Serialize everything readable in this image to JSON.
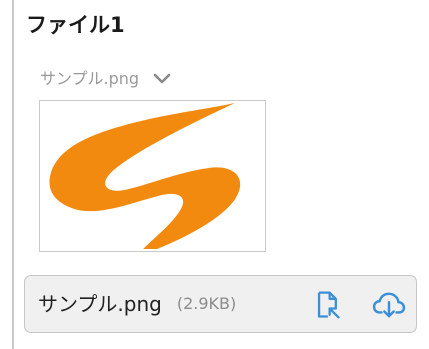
{
  "section": {
    "title": "ファイル1"
  },
  "preview": {
    "filename": "サンプル.png",
    "dropdown_icon": "chevron-down-icon",
    "image_colors": {
      "shape": "#f28a10"
    }
  },
  "file_card": {
    "name": "サンプル.png",
    "size": "(2.9KB)",
    "actions": [
      {
        "icon": "open-file-icon",
        "color": "#3a8fd8"
      },
      {
        "icon": "cloud-download-icon",
        "color": "#3a8fd8"
      }
    ]
  }
}
